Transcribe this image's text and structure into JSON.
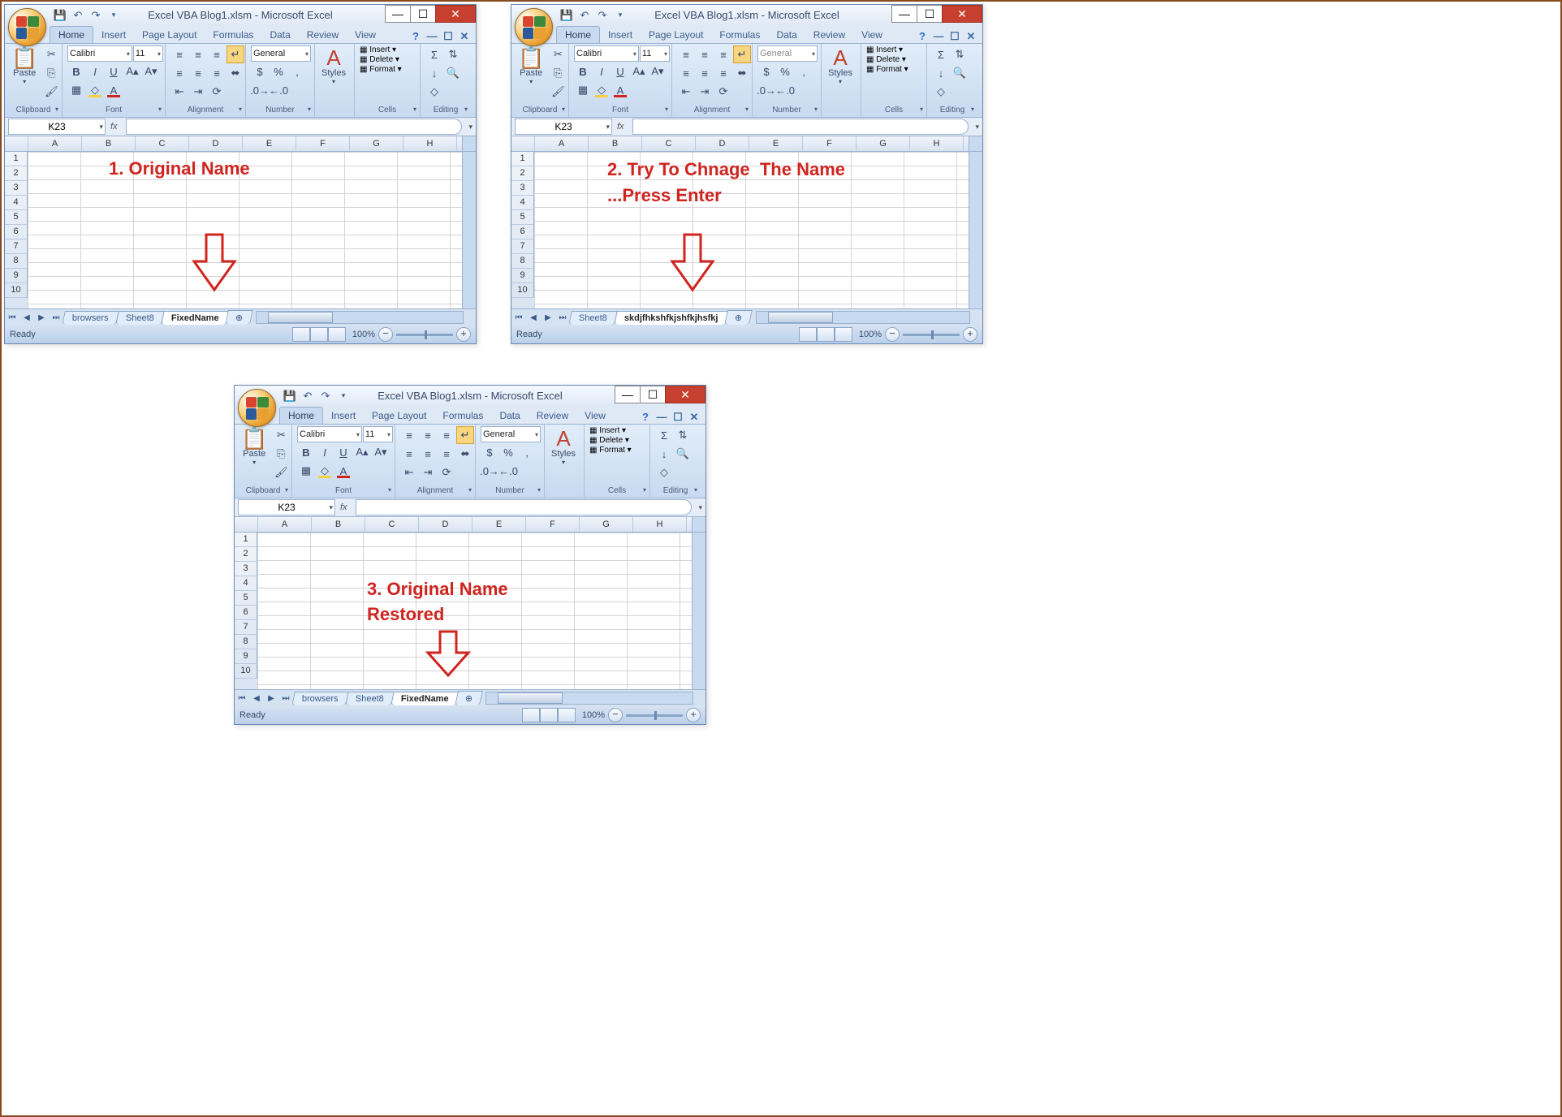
{
  "title": "Excel VBA Blog1.xlsm - Microsoft Excel",
  "ribbon_tabs": [
    "Home",
    "Insert",
    "Page Layout",
    "Formulas",
    "Data",
    "Review",
    "View"
  ],
  "active_tab": "Home",
  "groups": {
    "clipboard": "Clipboard",
    "font": "Font",
    "alignment": "Alignment",
    "number": "Number",
    "styles": "Styles",
    "cells": "Cells",
    "editing": "Editing"
  },
  "paste_label": "Paste",
  "font_name": "Calibri",
  "font_size": "11",
  "number_format": "General",
  "cells_ops": {
    "insert": "Insert",
    "delete": "Delete",
    "format": "Format"
  },
  "styles_label": "Styles",
  "name_box": "K23",
  "fx_label": "fx",
  "columns": [
    "A",
    "B",
    "C",
    "D",
    "E",
    "F",
    "G",
    "H"
  ],
  "rows": [
    1,
    2,
    3,
    4,
    5,
    6,
    7,
    8,
    9,
    10
  ],
  "status_ready": "Ready",
  "zoom": "100%",
  "windows": {
    "w1": {
      "annotation": "1. Original Name",
      "sheet_tabs": [
        "browsers",
        "Sheet8",
        "FixedName"
      ],
      "active_sheet": 2
    },
    "w2": {
      "annotation": "2. Try To Chnage  The Name\n...Press Enter",
      "sheet_tabs": [
        "Sheet8",
        "skdjfhkshfkjshfkjhsfkj"
      ],
      "active_sheet": 1
    },
    "w3": {
      "annotation": "3. Original Name\nRestored",
      "sheet_tabs": [
        "browsers",
        "Sheet8",
        "FixedName"
      ],
      "active_sheet": 2
    }
  }
}
